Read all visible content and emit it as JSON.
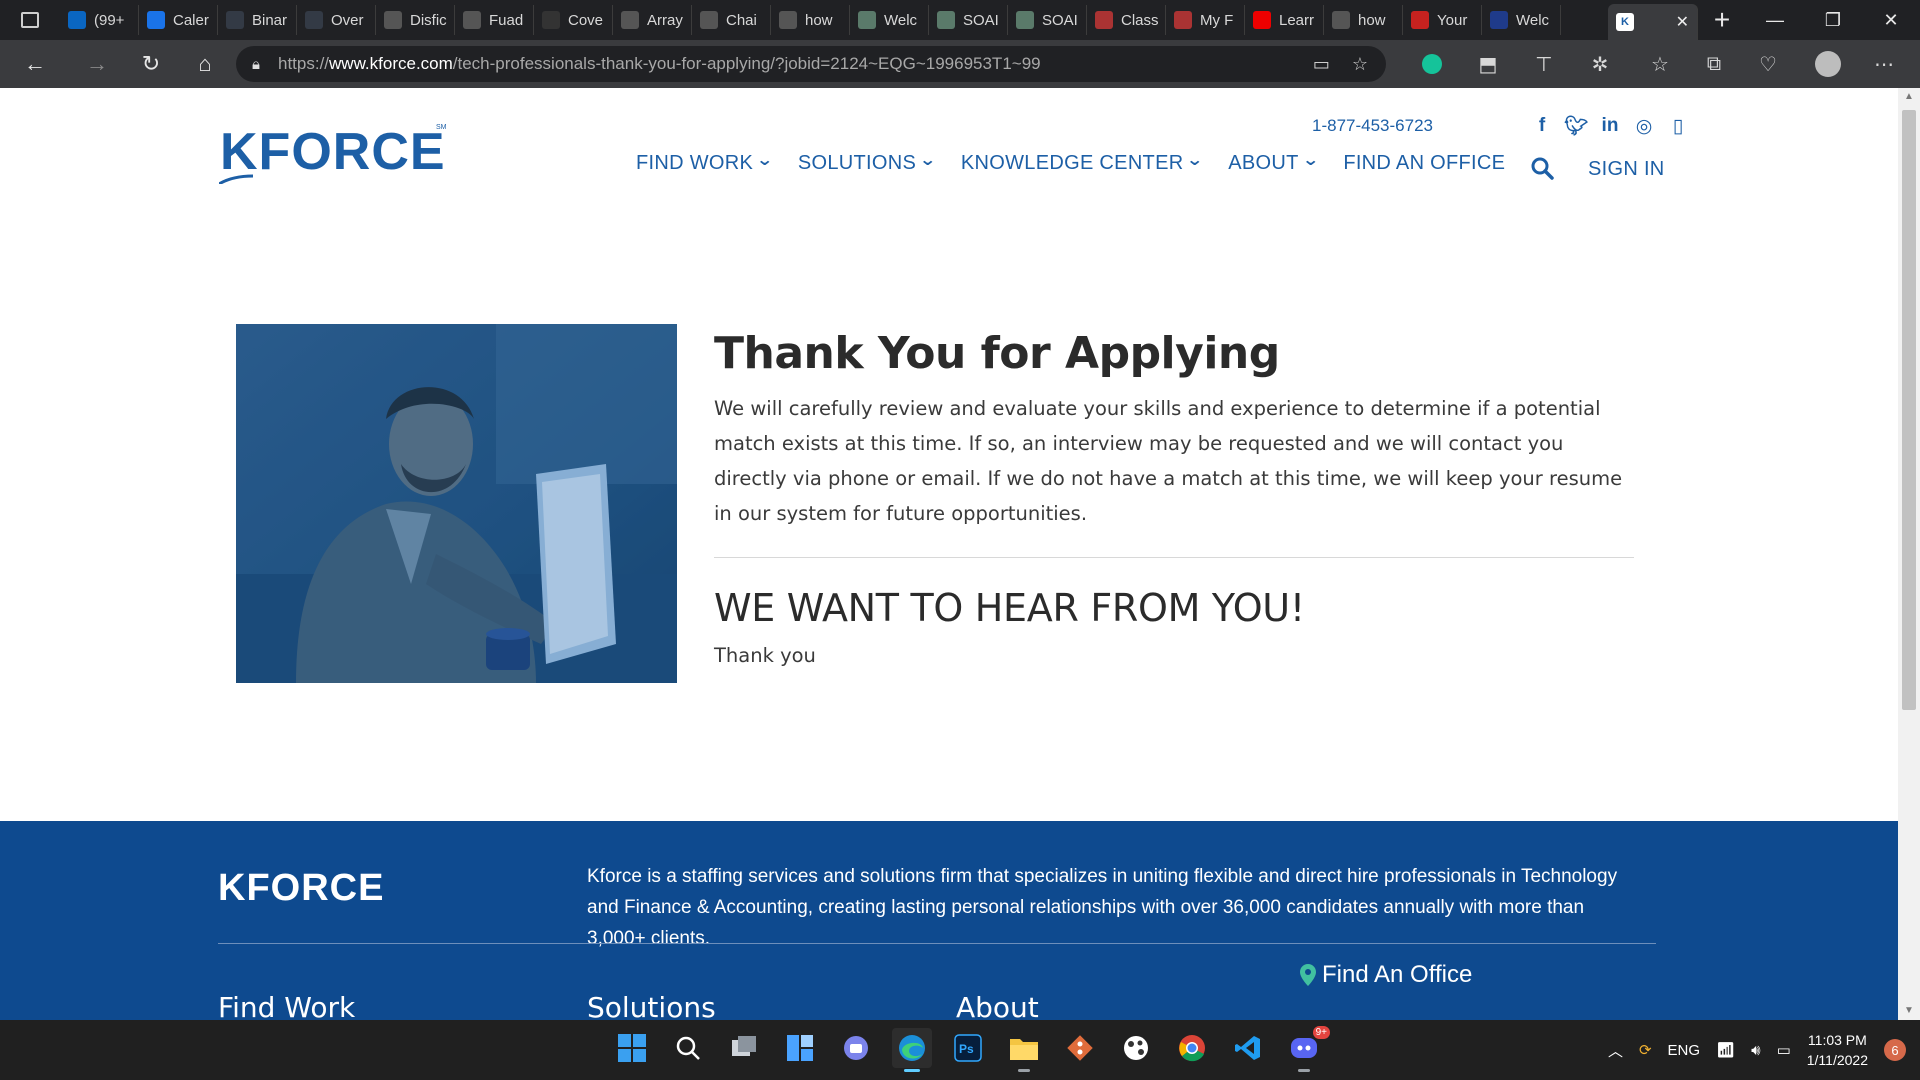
{
  "browser": {
    "tabs": [
      {
        "label": "(99+",
        "icon": "linkedin-icon",
        "color": "#0a66c2"
      },
      {
        "label": "Caler",
        "icon": "edge-icon",
        "color": "#1a73e8"
      },
      {
        "label": "Binar",
        "icon": "site-icon",
        "color": "#333a45"
      },
      {
        "label": "Over",
        "icon": "site-icon",
        "color": "#333a45"
      },
      {
        "label": "Disfic",
        "icon": "globe-icon",
        "color": "#555"
      },
      {
        "label": "Fuad",
        "icon": "github-icon",
        "color": "#555"
      },
      {
        "label": "Cove",
        "icon": "site-icon",
        "color": "#333"
      },
      {
        "label": "Array",
        "icon": "cap-icon",
        "color": "#555"
      },
      {
        "label": "Chai",
        "icon": "rainbow-icon",
        "color": "#555"
      },
      {
        "label": "how",
        "icon": "google-icon",
        "color": "#555"
      },
      {
        "label": "Welc",
        "icon": "s-icon",
        "color": "#5a7a6a"
      },
      {
        "label": "SOAI",
        "icon": "s-icon",
        "color": "#5a7a6a"
      },
      {
        "label": "SOAI",
        "icon": "s-icon",
        "color": "#5a7a6a"
      },
      {
        "label": "Class",
        "icon": "class-icon",
        "color": "#a33"
      },
      {
        "label": "My F",
        "icon": "pdf-icon",
        "color": "#a33"
      },
      {
        "label": "Learr",
        "icon": "youtube-icon",
        "color": "#e00"
      },
      {
        "label": "how",
        "icon": "google-icon",
        "color": "#555"
      },
      {
        "label": "Your",
        "icon": "gmail-icon",
        "color": "#c5221f"
      },
      {
        "label": "Welc",
        "icon": "site-icon",
        "color": "#1f3b8a"
      }
    ],
    "active_tab": {
      "label": "K",
      "icon": "kforce-icon"
    },
    "url_prefix": "https://",
    "url_domain": "www.kforce.com",
    "url_path": "/tech-professionals-thank-you-for-applying/?jobid=2124~EQG~1996953T1~99"
  },
  "site": {
    "logo": "KFORCE",
    "logo_mark": "SM",
    "phone": "1-877-453-6723",
    "social": [
      "f",
      "t",
      "in",
      "ig",
      "ph"
    ],
    "nav": [
      {
        "label": "FIND WORK",
        "chevron": true
      },
      {
        "label": "SOLUTIONS",
        "chevron": true
      },
      {
        "label": "KNOWLEDGE CENTER",
        "chevron": true
      },
      {
        "label": "ABOUT",
        "chevron": true
      },
      {
        "label": "FIND AN OFFICE",
        "chevron": false
      }
    ],
    "sign_in": "SIGN IN"
  },
  "main": {
    "title": "Thank You for Applying",
    "body": "We will carefully review and evaluate your skills and experience to determine if a potential match exists at this time. If so, an interview may be requested and we will contact you directly via phone or email. If we do not have a match at this time, we will keep your resume in our system for future opportunities.",
    "subheading": "WE WANT TO HEAR FROM YOU!",
    "closing": "Thank you"
  },
  "footer": {
    "logo": "KFORCE",
    "about": "Kforce is a staffing services and solutions firm that specializes in uniting flexible and direct hire professionals in Technology and Finance & Accounting, creating lasting personal relationships with over 36,000 candidates annually with more than 3,000+ clients.",
    "columns": [
      "Find Work",
      "Solutions",
      "About"
    ],
    "find_office": "Find An Office"
  },
  "taskbar": {
    "apps": [
      "windows-start-icon",
      "search-icon",
      "task-view-icon",
      "widgets-icon",
      "chat-icon",
      "edge-icon",
      "photoshop-icon",
      "file-explorer-icon",
      "git-icon",
      "paint-icon",
      "chrome-icon",
      "vscode-icon",
      "discord-icon"
    ],
    "discord_badge": "9+",
    "language": "ENG",
    "time": "11:03 PM",
    "date": "1/11/2022",
    "notifications": "6"
  },
  "colors": {
    "brand": "#1d5fa6",
    "footer_bg": "#0e4a8f",
    "tab_bg": "#202124",
    "address_bg": "#3a3b3e"
  }
}
